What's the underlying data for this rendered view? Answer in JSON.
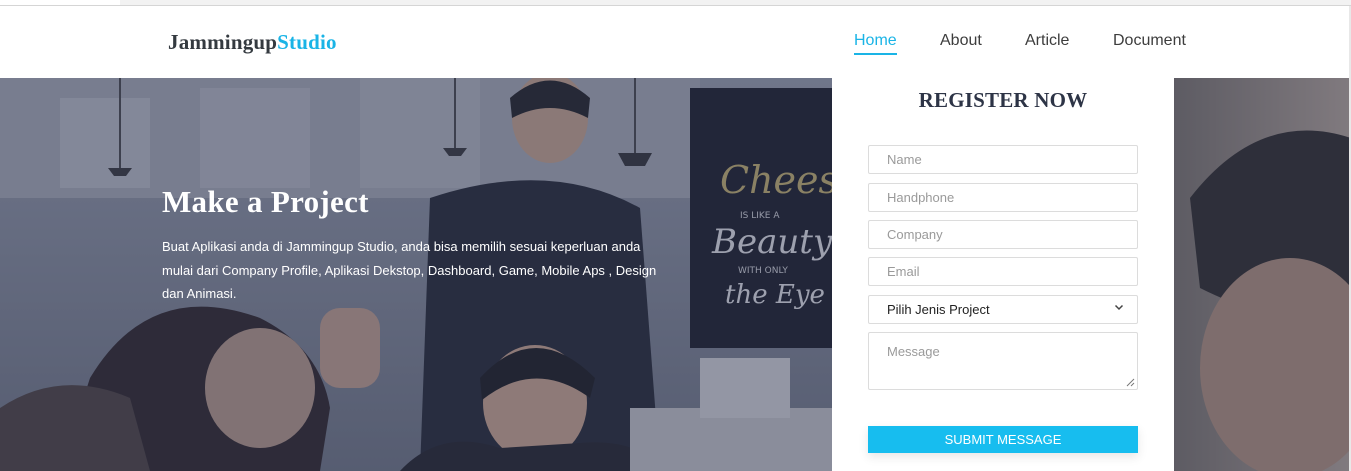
{
  "brand": {
    "part1": "Jammingup",
    "part2": "Studio"
  },
  "nav": {
    "items": [
      {
        "label": "Home",
        "active": true
      },
      {
        "label": "About",
        "active": false
      },
      {
        "label": "Article",
        "active": false
      },
      {
        "label": "Document",
        "active": false
      }
    ]
  },
  "hero": {
    "title": "Make a Project",
    "text": "Buat Aplikasi anda di Jammingup Studio, anda bisa memilih sesuai keperluan anda mulai dari Company Profile, Aplikasi Dekstop, Dashboard, Game, Mobile Aps , Design dan Animasi."
  },
  "register": {
    "title": "REGISTER NOW",
    "name_placeholder": "Name",
    "phone_placeholder": "Handphone",
    "company_placeholder": "Company",
    "email_placeholder": "Email",
    "project_select": "Pilih Jenis Project",
    "message_placeholder": "Message",
    "submit_label": "SUBMIT MESSAGE"
  },
  "background_poster": [
    "Cheese",
    "IS LIKE A",
    "Beauty",
    "WITH ONLY",
    "the Eye"
  ],
  "colors": {
    "accent": "#1ab4e6",
    "button": "#17bdef",
    "heading": "#2d3446"
  },
  "icons": {
    "select": "chevron-down-icon",
    "textarea": "resize-grip-icon"
  }
}
